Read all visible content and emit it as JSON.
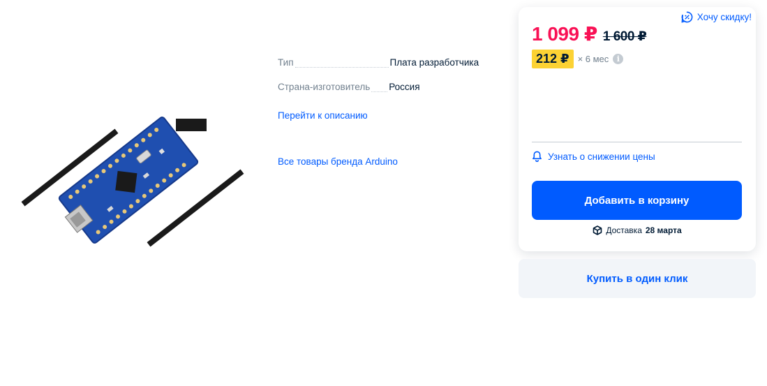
{
  "specs": [
    {
      "name": "Тип",
      "value": "Плата разработчика"
    },
    {
      "name": "Страна-изготовитель",
      "value": "Россия"
    }
  ],
  "links": {
    "description": "Перейти к описанию",
    "brand": "Все товары бренда Arduino"
  },
  "card": {
    "want_discount": "Хочу скидку!",
    "price": "1 099 ₽",
    "old_price": "1 600 ₽",
    "installment_amount": "212 ₽",
    "installment_term": "× 6 мес",
    "info_symbol": "i",
    "price_alert": "Узнать о снижении цены",
    "add_to_cart": "Добавить в корзину",
    "delivery_label": "Доставка",
    "delivery_date": "28 марта"
  },
  "buy_one_click": "Купить в один клик",
  "colors": {
    "accent": "#005bff",
    "price": "#f91155",
    "installment_badge": "#fcd234",
    "board": "#1f4fb0"
  },
  "icons": [
    "product-image-arduino-nano",
    "discount-icon",
    "bell-icon",
    "box-icon",
    "info-icon"
  ]
}
